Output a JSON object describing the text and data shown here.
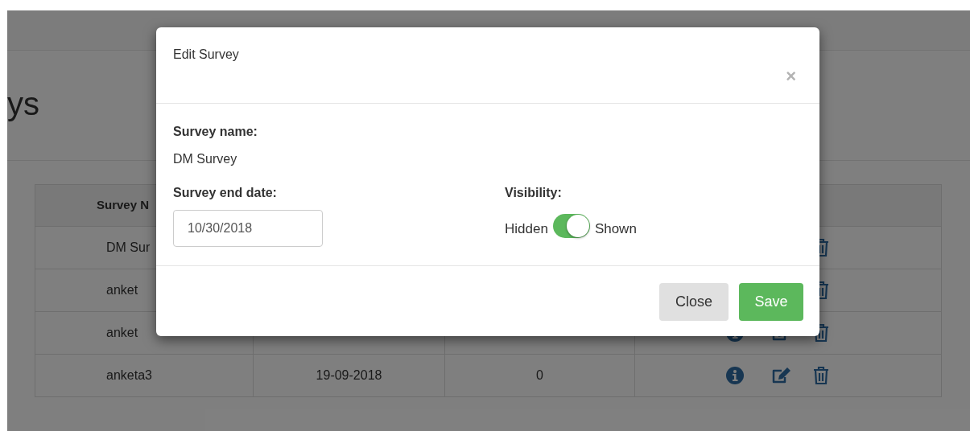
{
  "page": {
    "heading": "ys"
  },
  "table": {
    "columns": [
      "Survey N"
    ],
    "rows": [
      {
        "cells": [
          "DM Sur"
        ]
      },
      {
        "cells": [
          "anket"
        ]
      },
      {
        "cells": [
          "anket"
        ]
      },
      {
        "cells": [
          "anketa3",
          "19-09-2018",
          "0"
        ]
      }
    ]
  },
  "modal": {
    "title": "Edit Survey",
    "close": "×",
    "name_label": "Survey name:",
    "name_value": "DM Survey",
    "date_label": "Survey end date:",
    "date_value": "10/30/2018",
    "visibility": {
      "label": "Visibility:",
      "off_label": "Hidden",
      "on_label": "Shown",
      "on": true
    },
    "buttons": [
      {
        "label": "Close",
        "kind": "default"
      },
      {
        "label": "Save",
        "kind": "primary"
      }
    ]
  }
}
